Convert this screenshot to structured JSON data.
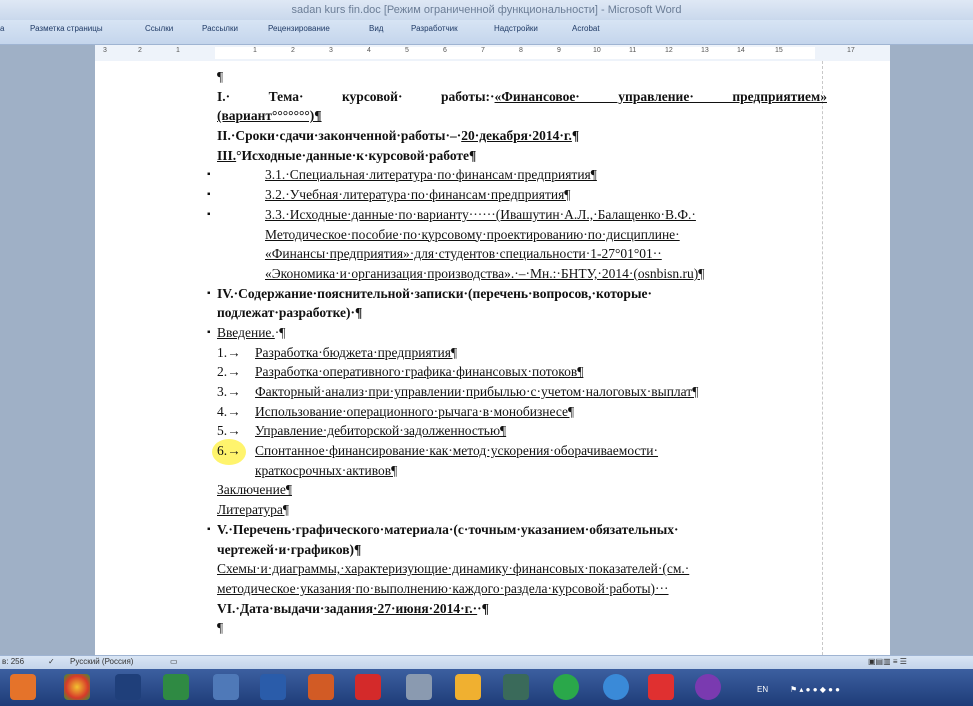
{
  "window": {
    "title": "sadan kurs fin.doc [Режим ограниченной функциональности] - Microsoft Word"
  },
  "ribbon": {
    "tabs": [
      "a",
      "Разметка страницы",
      "Ссылки",
      "Рассылки",
      "Рецензирование",
      "Вид",
      "Разработчик",
      "Надстройки",
      "Acrobat"
    ]
  },
  "ruler": {
    "marks": [
      "3",
      "2",
      "1",
      "1",
      "2",
      "3",
      "4",
      "5",
      "6",
      "7",
      "8",
      "9",
      "10",
      "11",
      "12",
      "13",
      "14",
      "15",
      "17"
    ]
  },
  "document": {
    "pilcrow": "¶",
    "l1_a": "I.· Тема· курсовой· работы:·",
    "l1_b": "«Финансовое· управление· предприятием»",
    "l2": "(вариант°°°°°°°)¶",
    "l3_a": "II.·Сроки·сдачи·законченной·работы·–·",
    "l3_b": "20·декабря·2014·г.",
    "l3_c": "¶",
    "l4_a": "III.",
    "l4_b": "°Исходные·данные·к·курсовой·работе¶",
    "l5": "3.1.·Специальная·литература·по·финансам·предприятия¶",
    "l6": "3.2.·Учебная·литература·по·финансам·предприятия¶",
    "l7": "3.3.·Исходные·данные·по·варианту······(Ивашутин·А.Л.,·Балащенко·В.Ф.·",
    "l8": "Методическое·пособие·по·курсовому·проектированию·по·дисциплине·",
    "l9": "«Финансы·предприятия»·для·студентов·специальности·1-27°01°01··",
    "l10": "«Экономика·и·организация·производства».·–·Мн.:·БНТУ,·2014·(osnbisn.ru)¶",
    "l11": "IV.·Содержание·пояснительной·записки·(перечень·вопросов,·которые·",
    "l12": "подлежат·разработке)·¶",
    "l13_a": "Введение.",
    "l13_b": "·¶",
    "items": [
      {
        "num": "1.→",
        "text": "Разработка·бюджета·предприятия¶"
      },
      {
        "num": "2.→",
        "text": "Разработка·оперативного·графика·финансовых·потоков¶"
      },
      {
        "num": "3.→",
        "text": "Факторный·анализ·при·управлении·прибылью·с·учетом·налоговых·выплат¶"
      },
      {
        "num": "4.→",
        "text": "Использование·операционного·рычага·в·монобизнесе¶"
      },
      {
        "num": "5.→",
        "text": "Управление·дебиторской·задолженностью¶"
      },
      {
        "num": "6.→",
        "text": "Спонтанное·финансирование·как·метод·ускорения·оборачиваемости·"
      }
    ],
    "item6_cont": "краткосрочных·активов¶",
    "l20": "Заключение¶",
    "l21": "Литература¶",
    "l22": "V.·Перечень·графического·материала·(с·точным·указанием·обязательных·",
    "l23": "чертежей·и·графиков)¶",
    "l24": "Схемы·и·диаграммы,·характеризующие·динамику·финансовых·показателей·(см.·",
    "l25": "методическое·указания·по·выполнению·каждого·раздела·курсовой·работы)···",
    "l26_a": "VI.·Дата·выдачи·задания",
    "l26_b": "·27·июня·2014·г.·",
    "l26_c": "·¶"
  },
  "status": {
    "words": "в: 256",
    "language": "Русский (Россия)"
  },
  "taskbar": {
    "lang": "EN"
  }
}
